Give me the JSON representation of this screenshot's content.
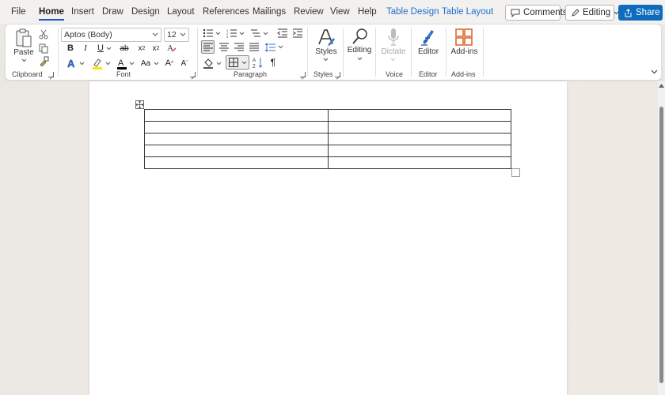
{
  "tabs": [
    {
      "label": "File"
    },
    {
      "label": "Home",
      "active": true
    },
    {
      "label": "Insert"
    },
    {
      "label": "Draw"
    },
    {
      "label": "Design"
    },
    {
      "label": "Layout"
    },
    {
      "label": "References"
    },
    {
      "label": "Mailings"
    },
    {
      "label": "Review"
    },
    {
      "label": "View"
    },
    {
      "label": "Help"
    },
    {
      "label": "Table Design",
      "contextual": true
    },
    {
      "label": "Table Layout",
      "contextual": true
    }
  ],
  "topbar": {
    "comments_label": "Comments",
    "editing_mode_label": "Editing",
    "share_label": "Share"
  },
  "ribbon": {
    "clipboard": {
      "paste_label": "Paste",
      "group_label": "Clipboard"
    },
    "font": {
      "font_name": "Aptos (Body)",
      "font_size": "12",
      "group_label": "Font",
      "font_color": "#000000",
      "highlight_color": "#ffe600"
    },
    "paragraph": {
      "group_label": "Paragraph"
    },
    "styles": {
      "styles_label": "Styles",
      "group_label": "Styles"
    },
    "editing": {
      "editing_label": "Editing"
    },
    "voice": {
      "dictate_label": "Dictate",
      "group_label": "Voice"
    },
    "editor": {
      "editor_label": "Editor",
      "group_label": "Editor"
    },
    "addins": {
      "addins_label": "Add-ins",
      "group_label": "Add-ins"
    }
  },
  "document": {
    "table": {
      "rows": 5,
      "cols": 2,
      "cells": [
        [
          "",
          ""
        ],
        [
          "",
          ""
        ],
        [
          "",
          ""
        ],
        [
          "",
          ""
        ],
        [
          "",
          ""
        ]
      ]
    }
  },
  "colors": {
    "accent": "#185abd",
    "contextual_tab": "#1f6fd0",
    "share_button": "#0f6cbd",
    "addins_icon": "#e0672b"
  }
}
